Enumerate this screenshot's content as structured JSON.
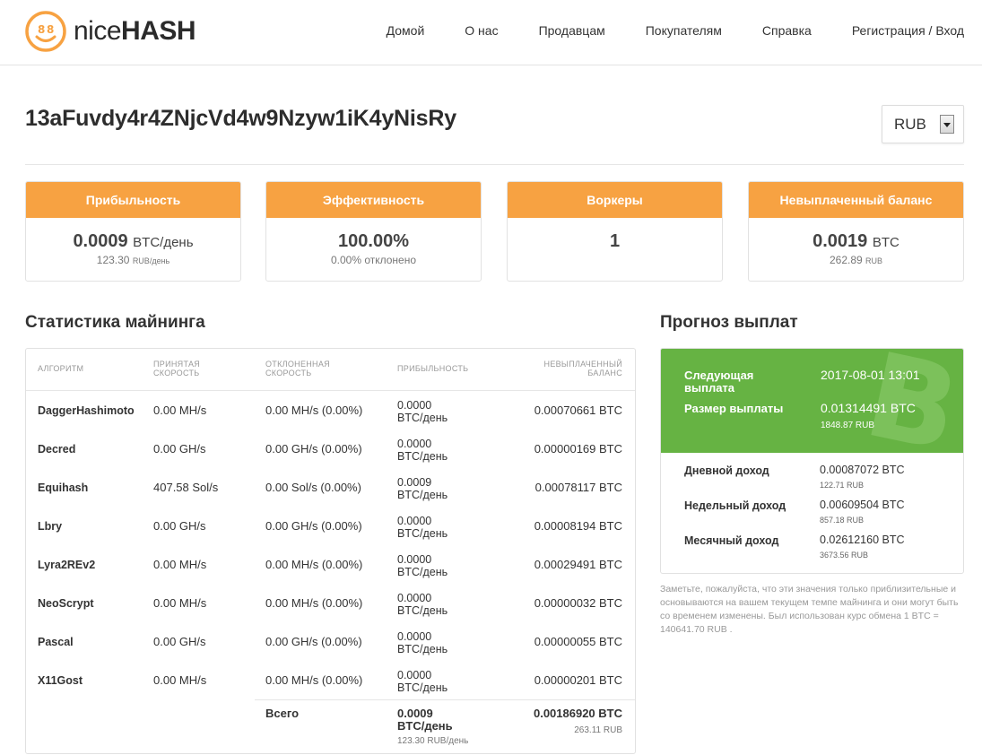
{
  "header": {
    "logo": {
      "text_light": "nice",
      "text_bold": "HASH"
    },
    "nav": [
      "Домой",
      "О нас",
      "Продавцам",
      "Покупателям",
      "Справка",
      "Регистрация / Вход"
    ]
  },
  "address": "13aFuvdy4r4ZNjcVd4w9Nzyw1iK4yNisRy",
  "currency_select": {
    "value": "RUB"
  },
  "cards": [
    {
      "title": "Прибыльность",
      "value": "0.0009",
      "unit": "BTC/день",
      "sub_value": "123.30",
      "sub_unit": "RUB/день"
    },
    {
      "title": "Эффективность",
      "value": "100.00%",
      "unit": "",
      "sub_value": "0.00% отклонено",
      "sub_unit": ""
    },
    {
      "title": "Воркеры",
      "value": "1",
      "unit": "",
      "sub_value": "",
      "sub_unit": ""
    },
    {
      "title": "Невыплаченный баланс",
      "value": "0.0019",
      "unit": "BTC",
      "sub_value": "262.89",
      "sub_unit": "RUB"
    }
  ],
  "mining": {
    "title": "Статистика майнинга",
    "headers": {
      "algo": "АЛГОРИТМ",
      "accepted": [
        "ПРИНЯТАЯ",
        "СКОРОСТЬ"
      ],
      "rejected": [
        "ОТКЛОНЕННАЯ",
        "СКОРОСТЬ"
      ],
      "profit": "ПРИБЫЛЬНОСТЬ",
      "unpaid": [
        "НЕВЫПЛАЧЕННЫЙ",
        "БАЛАНС"
      ]
    },
    "rows": [
      {
        "algo": "DaggerHashimoto",
        "accepted": "0.00 MH/s",
        "rejected": "0.00 MH/s (0.00%)",
        "profit1": "0.0000",
        "profit2": "BTC/день",
        "unpaid": "0.00070661 BTC"
      },
      {
        "algo": "Decred",
        "accepted": "0.00 GH/s",
        "rejected": "0.00 GH/s (0.00%)",
        "profit1": "0.0000",
        "profit2": "BTC/день",
        "unpaid": "0.00000169 BTC"
      },
      {
        "algo": "Equihash",
        "accepted": "407.58 Sol/s",
        "rejected": "0.00 Sol/s (0.00%)",
        "profit1": "0.0009",
        "profit2": "BTC/день",
        "unpaid": "0.00078117 BTC"
      },
      {
        "algo": "Lbry",
        "accepted": "0.00 GH/s",
        "rejected": "0.00 GH/s (0.00%)",
        "profit1": "0.0000",
        "profit2": "BTC/день",
        "unpaid": "0.00008194 BTC"
      },
      {
        "algo": "Lyra2REv2",
        "accepted": "0.00 MH/s",
        "rejected": "0.00 MH/s (0.00%)",
        "profit1": "0.0000",
        "profit2": "BTC/день",
        "unpaid": "0.00029491 BTC"
      },
      {
        "algo": "NeoScrypt",
        "accepted": "0.00 MH/s",
        "rejected": "0.00 MH/s (0.00%)",
        "profit1": "0.0000",
        "profit2": "BTC/день",
        "unpaid": "0.00000032 BTC"
      },
      {
        "algo": "Pascal",
        "accepted": "0.00 GH/s",
        "rejected": "0.00 GH/s (0.00%)",
        "profit1": "0.0000",
        "profit2": "BTC/день",
        "unpaid": "0.00000055 BTC"
      },
      {
        "algo": "X11Gost",
        "accepted": "0.00 MH/s",
        "rejected": "0.00 MH/s (0.00%)",
        "profit1": "0.0000",
        "profit2": "BTC/день",
        "unpaid": "0.00000201 BTC"
      }
    ],
    "total": {
      "label": "Всего",
      "profit1": "0.0009",
      "profit2": "BTC/день",
      "profit_rub": "123.30 RUB/день",
      "unpaid": "0.00186920 BTC",
      "unpaid_rub": "263.11 RUB"
    }
  },
  "forecast": {
    "title": "Прогноз выплат",
    "next_label": [
      "Следующая",
      "выплата"
    ],
    "next_value": "2017-08-01 13:01",
    "size_label": "Размер выплаты",
    "size_value": "0.01314491 BTC",
    "size_rub": "1848.87 RUB",
    "rows": [
      {
        "label": "Дневной доход",
        "value": "0.00087072 BTC",
        "sub": "122.71 RUB"
      },
      {
        "label": "Недельный доход",
        "value": "0.00609504 BTC",
        "sub": "857.18 RUB"
      },
      {
        "label": "Месячный доход",
        "value": "0.02612160 BTC",
        "sub": "3673.56 RUB"
      }
    ],
    "note": "Заметьте, пожалуйста, что эти значения только приблизительные и основываются на вашем текущем темпе майнинга и они могут быть со временем изменены. Был использован курс обмена 1 BTC = 140641.70 RUB ."
  },
  "colors": {
    "accent_orange": "#f7a242",
    "forecast_green": "#66b343"
  }
}
